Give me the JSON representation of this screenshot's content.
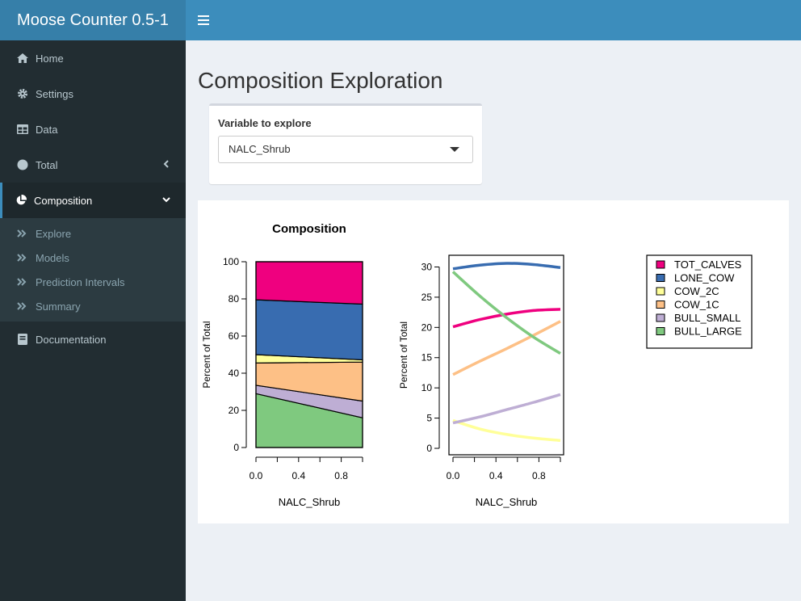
{
  "app": {
    "title": "Moose Counter 0.5-1"
  },
  "sidebar": {
    "items": [
      {
        "label": "Home"
      },
      {
        "label": "Settings"
      },
      {
        "label": "Data"
      },
      {
        "label": "Total"
      },
      {
        "label": "Composition"
      },
      {
        "label": "Documentation"
      }
    ],
    "submenu": [
      {
        "label": "Explore"
      },
      {
        "label": "Models"
      },
      {
        "label": "Prediction Intervals"
      },
      {
        "label": "Summary"
      }
    ]
  },
  "main": {
    "title": "Composition Exploration",
    "variable_label": "Variable to explore",
    "variable_value": "NALC_Shrub"
  },
  "colors": {
    "TOT_CALVES": "#ef007f",
    "LONE_COW": "#386cb0",
    "COW_2C": "#ffff99",
    "COW_1C": "#fdc086",
    "BULL_SMALL": "#beaed4",
    "BULL_LARGE": "#7fc97f"
  },
  "chart_data": [
    {
      "type": "area",
      "title": "Composition",
      "xlabel": "NALC_Shrub",
      "ylabel": "Percent of Total",
      "xlim": [
        0,
        1
      ],
      "ylim": [
        0,
        100
      ],
      "x_ticks": [
        "0.0",
        "0.4",
        "0.8"
      ],
      "y_ticks": [
        "0",
        "20",
        "40",
        "60",
        "80",
        "100"
      ],
      "x": [
        0,
        1
      ],
      "series": [
        {
          "name": "BULL_LARGE",
          "values": [
            29,
            16
          ]
        },
        {
          "name": "BULL_SMALL",
          "values": [
            4.5,
            9
          ]
        },
        {
          "name": "COW_1C",
          "values": [
            12,
            21
          ]
        },
        {
          "name": "COW_2C",
          "values": [
            4.5,
            1.2
          ]
        },
        {
          "name": "LONE_COW",
          "values": [
            29.5,
            30
          ]
        },
        {
          "name": "TOT_CALVES",
          "values": [
            20.5,
            22.8
          ]
        }
      ]
    },
    {
      "type": "line",
      "xlabel": "NALC_Shrub",
      "ylabel": "Percent of Total",
      "xlim": [
        0,
        1
      ],
      "ylim": [
        0,
        31
      ],
      "x_ticks": [
        "0.0",
        "0.4",
        "0.8"
      ],
      "y_ticks": [
        "0",
        "5",
        "10",
        "15",
        "20",
        "25",
        "30"
      ],
      "x": [
        0,
        0.25,
        0.5,
        0.75,
        1
      ],
      "series": [
        {
          "name": "TOT_CALVES",
          "values": [
            20.1,
            21.3,
            22.2,
            22.8,
            23.0
          ]
        },
        {
          "name": "LONE_COW",
          "values": [
            29.7,
            30.3,
            30.6,
            30.4,
            29.9
          ]
        },
        {
          "name": "COW_2C",
          "values": [
            4.6,
            3.2,
            2.3,
            1.7,
            1.3
          ]
        },
        {
          "name": "COW_1C",
          "values": [
            12.2,
            14.4,
            16.5,
            18.7,
            21.0
          ]
        },
        {
          "name": "BULL_SMALL",
          "values": [
            4.2,
            5.2,
            6.4,
            7.6,
            8.9
          ]
        },
        {
          "name": "BULL_LARGE",
          "values": [
            29.2,
            25.2,
            21.6,
            18.4,
            15.7
          ]
        }
      ],
      "legend": [
        "TOT_CALVES",
        "LONE_COW",
        "COW_2C",
        "COW_1C",
        "BULL_SMALL",
        "BULL_LARGE"
      ],
      "legend_position": "right"
    }
  ]
}
